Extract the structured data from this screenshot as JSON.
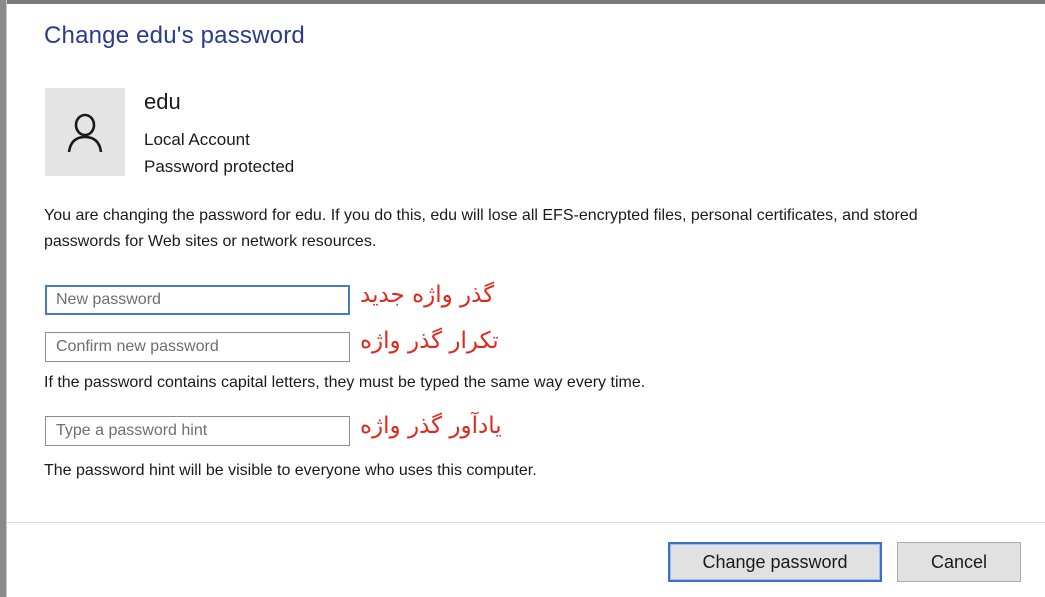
{
  "dialog": {
    "title": "Change edu's password"
  },
  "account": {
    "name": "edu",
    "type": "Local Account",
    "status": "Password protected"
  },
  "warning_text": "You are changing the password for edu.  If you do this, edu will lose all EFS-encrypted files, personal certificates, and stored passwords for Web sites or network resources.",
  "fields": {
    "new_password": {
      "placeholder": "New password",
      "value": "",
      "annotation": "گذر واژه جدید"
    },
    "confirm_password": {
      "placeholder": "Confirm new password",
      "value": "",
      "annotation": "تکرار گذر واژه"
    },
    "hint": {
      "placeholder": "Type a password hint",
      "value": "",
      "annotation": "یادآور گذر واژه"
    }
  },
  "notes": {
    "capitals": "If the password contains capital letters, they must be typed the same way every time.",
    "hint_visible": "The password hint will be visible to everyone who uses this computer."
  },
  "buttons": {
    "change": "Change password",
    "cancel": "Cancel"
  },
  "icons": {
    "avatar": "user-icon"
  },
  "colors": {
    "title": "#2b3a8f",
    "annotation": "#e0281e",
    "focus_border": "#4a78c8"
  }
}
